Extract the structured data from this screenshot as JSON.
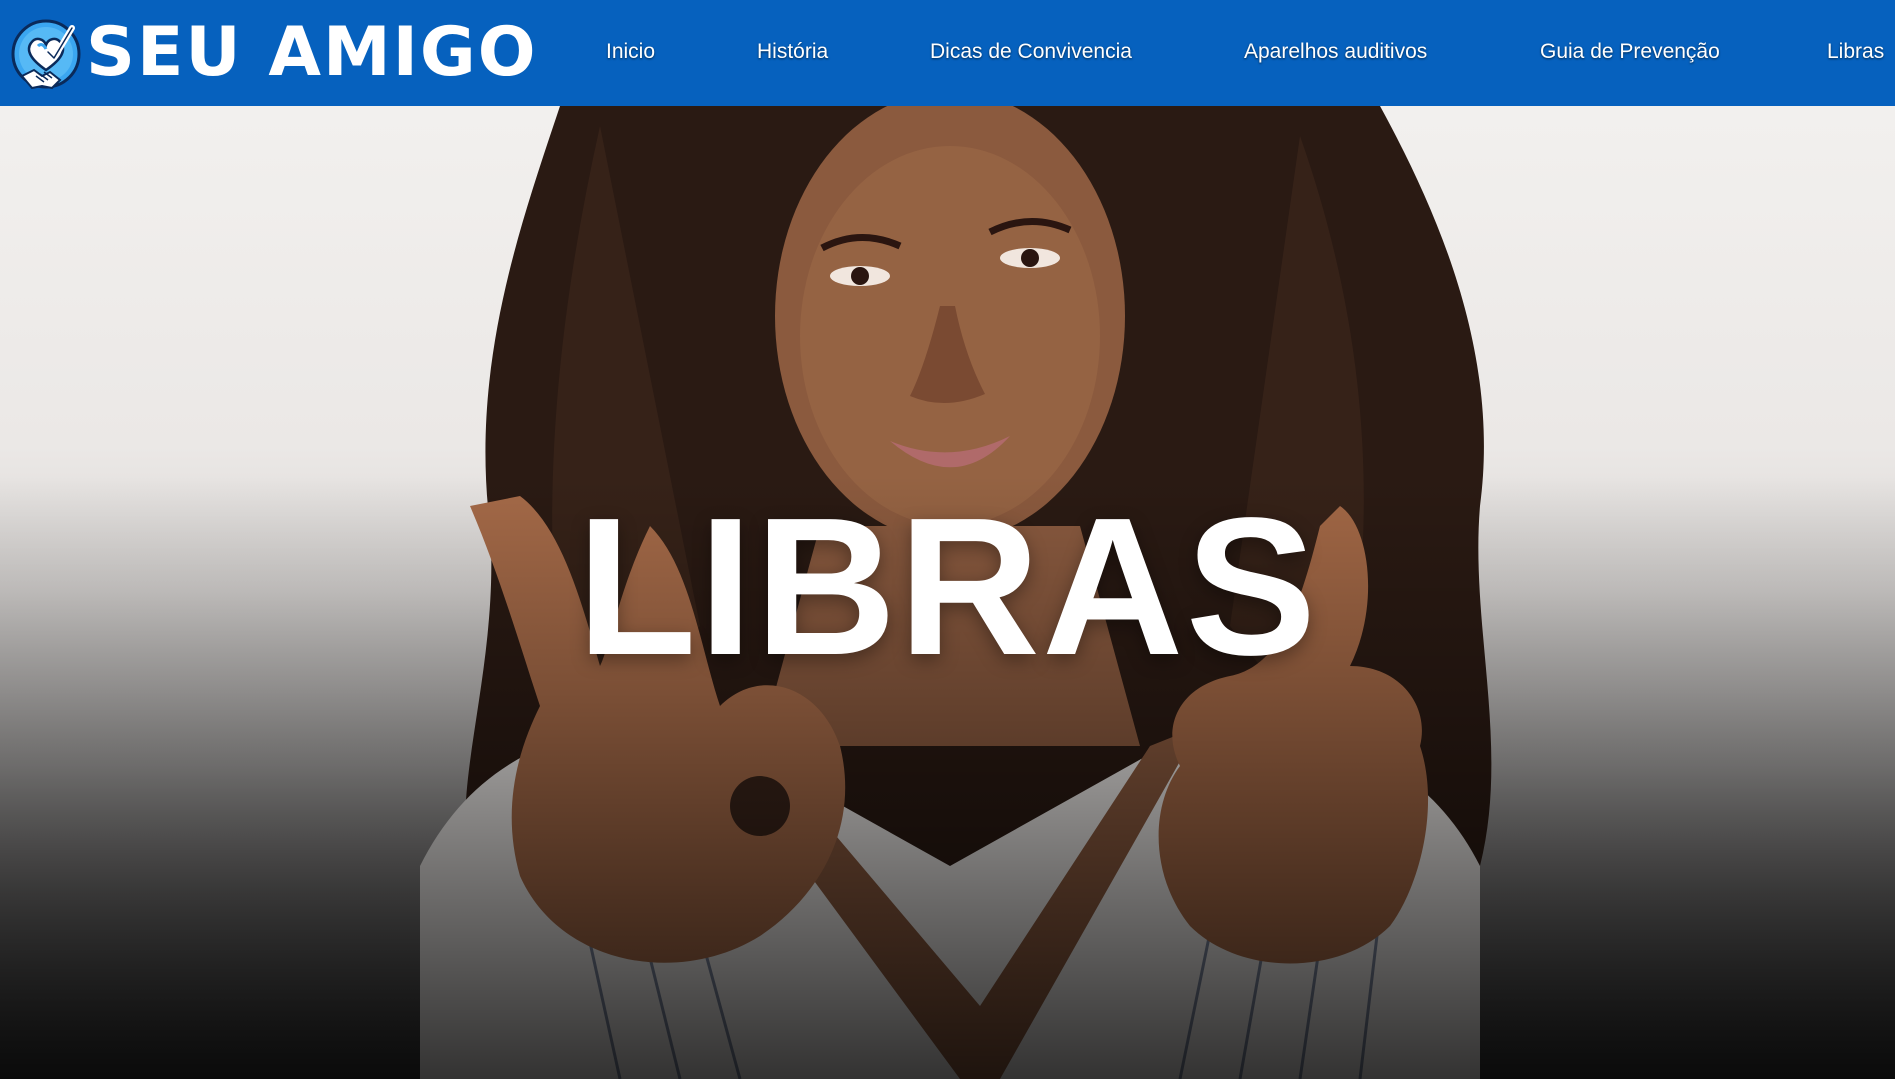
{
  "brand": {
    "name": "SEU AMIGO",
    "logo_icon": "heart-handshake-icon",
    "color": "#0661be"
  },
  "nav": {
    "items": [
      {
        "label": "Inicio"
      },
      {
        "label": "História"
      },
      {
        "label": "Dicas de Convivencia"
      },
      {
        "label": "Aparelhos auditivos"
      },
      {
        "label": "Guia de Prevenção"
      },
      {
        "label": "Libras"
      }
    ]
  },
  "hero": {
    "title": "LIBRAS",
    "image": "woman-signing-ok-and-thumbs-up-photo"
  }
}
